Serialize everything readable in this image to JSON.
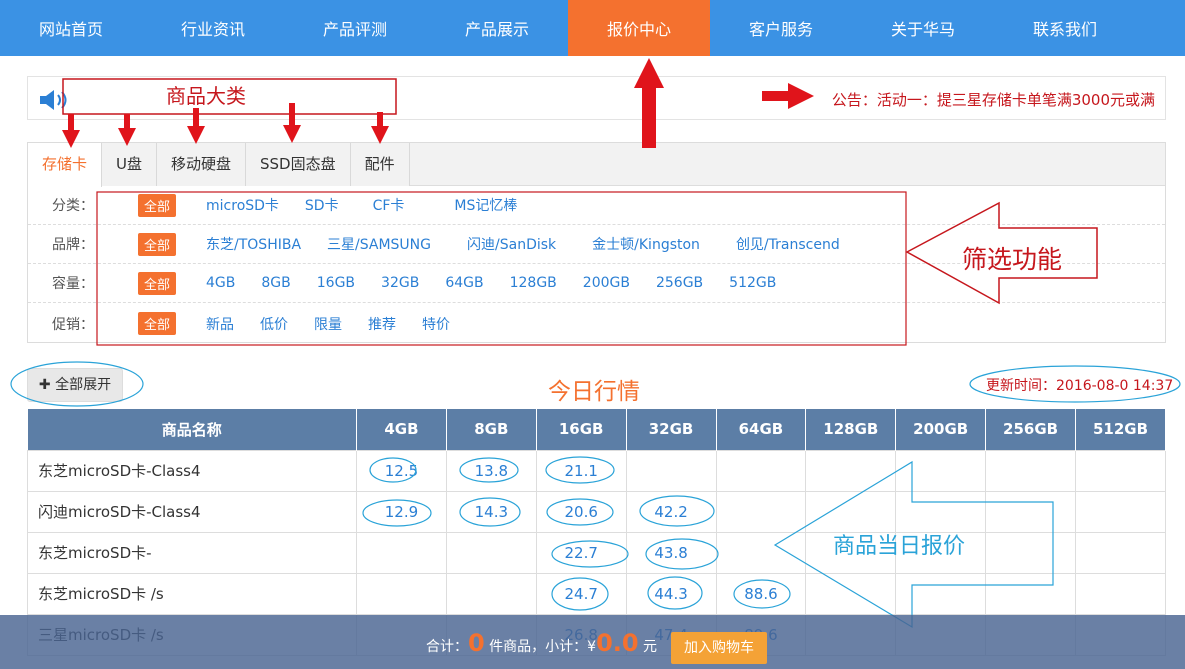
{
  "nav": {
    "items": [
      "网站首页",
      "行业资讯",
      "产品评测",
      "产品展示",
      "报价中心",
      "客户服务",
      "关于华马",
      "联系我们"
    ],
    "active_index": 4
  },
  "notice": {
    "text": "公告：活动一：提三星存储卡单笔满3000元或满"
  },
  "tabs": [
    "存储卡",
    "U盘",
    "移动硬盘",
    "SSD固态盘",
    "配件"
  ],
  "filters": [
    {
      "label": "分类：",
      "all": "全部",
      "options": [
        "microSD卡",
        "SD卡",
        "CF卡",
        "MS记忆棒"
      ]
    },
    {
      "label": "品牌：",
      "all": "全部",
      "options": [
        "东芝/TOSHIBA",
        "三星/SAMSUNG",
        "闪迪/SanDisk",
        "金士顿/Kingston",
        "创见/Transcend"
      ]
    },
    {
      "label": "容量：",
      "all": "全部",
      "options": [
        "4GB",
        "8GB",
        "16GB",
        "32GB",
        "64GB",
        "128GB",
        "200GB",
        "256GB",
        "512GB"
      ]
    },
    {
      "label": "促销：",
      "all": "全部",
      "options": [
        "新品",
        "低价",
        "限量",
        "推荐",
        "特价"
      ]
    }
  ],
  "expand_button": "全部展开",
  "today_title": "今日行情",
  "update_time": "更新时间：2016-08-0  14:37",
  "table": {
    "headers": [
      "商品名称",
      "4GB",
      "8GB",
      "16GB",
      "32GB",
      "64GB",
      "128GB",
      "200GB",
      "256GB",
      "512GB"
    ],
    "rows": [
      [
        "东芝microSD卡-Class4",
        "12.5",
        "13.8",
        "21.1",
        "",
        "",
        "",
        "",
        "",
        ""
      ],
      [
        "闪迪microSD卡-Class4",
        "12.9",
        "14.3",
        "20.6",
        "42.2",
        "",
        "",
        "",
        "",
        ""
      ],
      [
        "东芝microSD卡-",
        "",
        "",
        "22.7",
        "43.8",
        "",
        "",
        "",
        "",
        ""
      ],
      [
        "东芝microSD卡     /s",
        "",
        "",
        "24.7",
        "44.3",
        "88.6",
        "",
        "",
        "",
        ""
      ],
      [
        "三星microSD卡     /s",
        "",
        "",
        "26.8",
        "47.4",
        "89.6",
        "",
        "",
        "",
        ""
      ]
    ]
  },
  "bottom_bar": {
    "total_label": "合计：",
    "count": "0",
    "count_unit": "件商品，小计：¥",
    "subtotal": "0.0",
    "currency_unit": "元",
    "cart_button": "加入购物车"
  },
  "annotations": {
    "category": "商品大类",
    "filter": "筛选功能",
    "quote": "商品当日报价"
  },
  "colors": {
    "nav": "#3b92e4",
    "accent": "#f4712f",
    "link": "#2b7fd4",
    "header_row": "#5c7ea6",
    "annotation_red": "#c6171d"
  }
}
